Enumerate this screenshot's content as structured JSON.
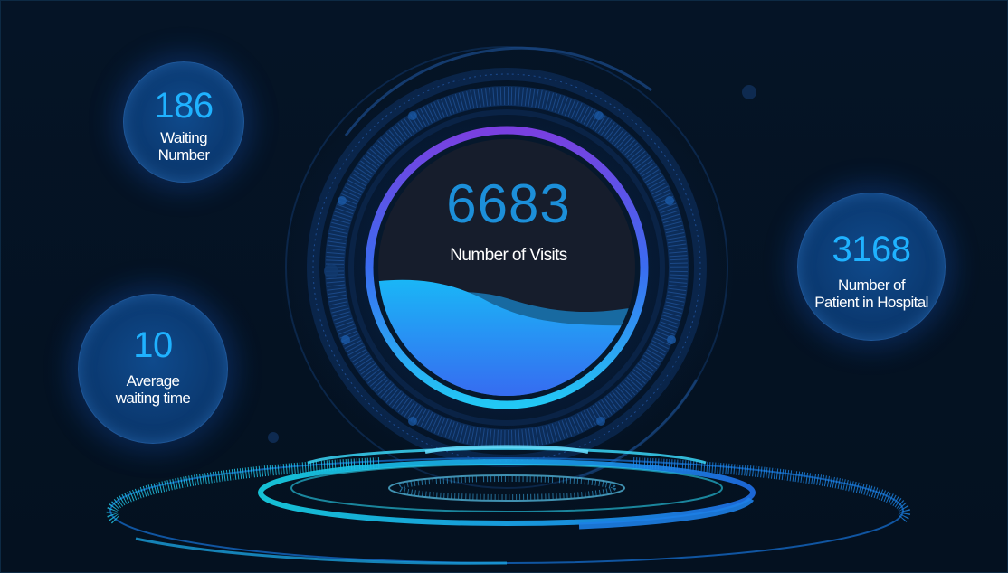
{
  "center": {
    "value": "6683",
    "label": "Number of Visits",
    "wave_fill_level": 0.4
  },
  "stats": {
    "waiting": {
      "value": "186",
      "label_lines": [
        "Waiting",
        "Number"
      ]
    },
    "avg_time": {
      "value": "10",
      "label_lines": [
        "Average",
        "waiting time"
      ]
    },
    "in_hospital": {
      "value": "3168",
      "label_lines": [
        "Number of",
        "Patient in Hospital"
      ]
    }
  },
  "colors": {
    "background": "#04111f",
    "accent_blue": "#1fb2ff",
    "center_number": "#1c8fd9",
    "ring_purple": "#6b4be6",
    "ring_cyan": "#2ad4f0"
  }
}
